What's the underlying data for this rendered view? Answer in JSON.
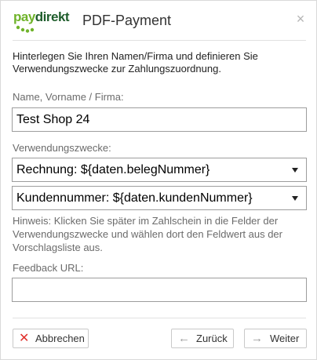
{
  "header": {
    "logo_pay": "pay",
    "logo_direkt": "direkt",
    "title": "PDF-Payment",
    "close_symbol": "×"
  },
  "intro": "Hinterlegen Sie Ihren Namen/Firma und definieren Sie Verwendungszwecke zur Zahlungszuordnung.",
  "name_field": {
    "label": "Name, Vorname / Firma:",
    "value": "Test Shop 24"
  },
  "purposes": {
    "label": "Verwendungszwecke:",
    "select1_value": "Rechnung: ${daten.belegNummer}",
    "select2_value": "Kundennummer: ${daten.kundenNummer}"
  },
  "hint": "Hinweis: Klicken Sie später im Zahlschein in die Felder der Verwendungszwecke und wählen dort den Feldwert aus der Vorschlagsliste aus.",
  "feedback": {
    "label": "Feedback URL:",
    "value": ""
  },
  "buttons": {
    "cancel_label": "Abbrechen",
    "back_label": "Zurück",
    "next_label": "Weiter"
  },
  "icons": {
    "logo": "paydirekt-logo",
    "close": "close-icon",
    "cancel": "x-icon",
    "back": "arrow-left-icon",
    "next": "arrow-right-icon",
    "dropdown": "triangle-down-icon"
  },
  "colors": {
    "logo_pay": "#6fb32a",
    "logo_direkt": "#1f5d2c",
    "cancel_icon": "#e0302b"
  }
}
